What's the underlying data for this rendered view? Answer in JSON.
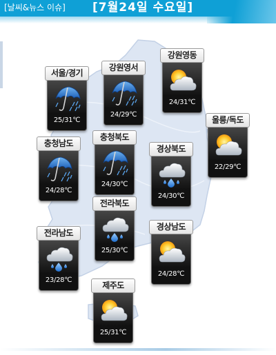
{
  "header": {
    "category": "[날씨&뉴스 이슈]",
    "date": "[7월24일 수요일]"
  },
  "colors": {
    "header_blue": "#0fa0d6",
    "map_fill": "#dde6f3",
    "card_dark": "#1b1b1b"
  },
  "regions": [
    {
      "name": "서울/경기",
      "weather": "rain-icon",
      "temp": "25/31℃"
    },
    {
      "name": "강원영서",
      "weather": "rain-icon",
      "temp": "24/29℃"
    },
    {
      "name": "강원영동",
      "weather": "partly-cloudy-icon",
      "temp": "24/31℃"
    },
    {
      "name": "울릉/독도",
      "weather": "partly-cloudy-icon",
      "temp": "22/29℃"
    },
    {
      "name": "충청남도",
      "weather": "rain-icon",
      "temp": "24/28℃"
    },
    {
      "name": "충청북도",
      "weather": "rain-icon",
      "temp": "24/30℃"
    },
    {
      "name": "경상북도",
      "weather": "cloud-rain-icon",
      "temp": "24/30℃"
    },
    {
      "name": "전라북도",
      "weather": "cloud-rain-icon",
      "temp": "25/30℃"
    },
    {
      "name": "전라남도",
      "weather": "cloud-rain-icon",
      "temp": "23/28℃"
    },
    {
      "name": "경상남도",
      "weather": "partly-cloudy-icon",
      "temp": "24/28℃"
    },
    {
      "name": "제주도",
      "weather": "partly-cloudy-icon",
      "temp": "25/31℃"
    }
  ]
}
